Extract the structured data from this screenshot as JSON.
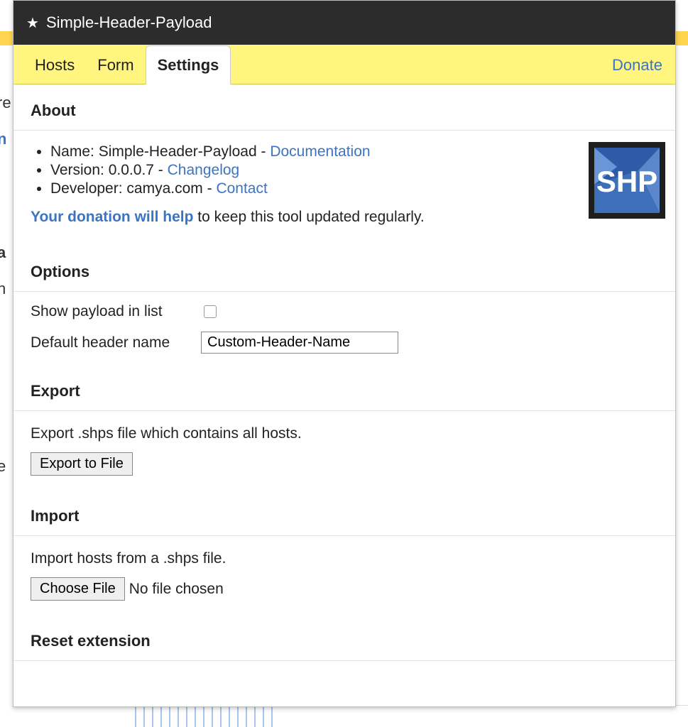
{
  "header": {
    "title": "Simple-Header-Payload"
  },
  "tabs": {
    "hosts": "Hosts",
    "form": "Form",
    "settings": "Settings",
    "donate": "Donate"
  },
  "about": {
    "heading": "About",
    "name_label": "Name:",
    "name_value": "Simple-Header-Payload",
    "doc_link": "Documentation",
    "version_label": "Version:",
    "version_value": "0.0.0.7",
    "changelog_link": "Changelog",
    "dev_label": "Developer:",
    "dev_value": "camya.com",
    "contact_link": "Contact",
    "donation_bold": "Your donation will help",
    "donation_rest": " to keep this tool updated regularly.",
    "logo_text": "SHP"
  },
  "options": {
    "heading": "Options",
    "show_payload_label": "Show payload in list",
    "default_header_label": "Default header name",
    "default_header_value": "Custom-Header-Name"
  },
  "export": {
    "heading": "Export",
    "desc": "Export .shps file which contains all hosts.",
    "button": "Export to File"
  },
  "import": {
    "heading": "Import",
    "desc": "Import hosts from a .shps file.",
    "choose_button": "Choose File",
    "no_file": "No file chosen"
  },
  "reset": {
    "heading": "Reset extension"
  }
}
